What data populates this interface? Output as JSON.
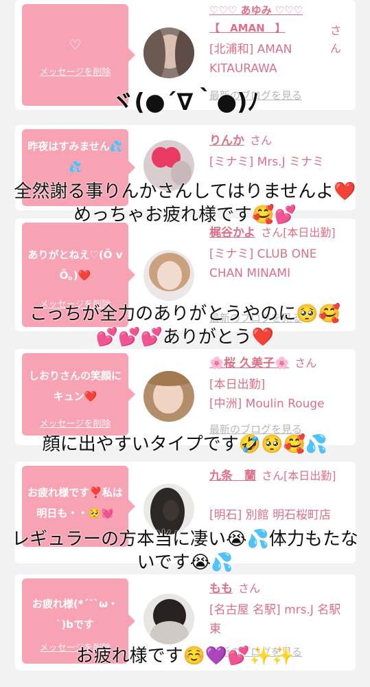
{
  "cards": [
    {
      "bubble_message": "♡",
      "delete_label": "メッセージを削除",
      "name": "♡♡♡ あゆみ ♡♡♡\n【　AMAN　】",
      "honorific": "さん",
      "shop": "[北浦和] AMAN KITAURAWA",
      "blog_label": "最新のブログを見る"
    },
    {
      "bubble_message": "昨夜はすみません💦💦",
      "delete_label": "",
      "name": "りんか",
      "honorific": "さん",
      "shop": "[ミナミ] Mrs.J ミナミ",
      "blog_label": ""
    },
    {
      "bubble_message": "ありがとねえ♡(Ö vÖ｡)❤️",
      "delete_label": "メッセージを削除",
      "name": "梶谷かよ",
      "honorific": "さん[本日出勤]",
      "shop": "[ミナミ] CLUB ONE CHAN MINAMI",
      "blog_label": "最新のブログを見る"
    },
    {
      "bubble_message": "しおりさんの笑顔にキュン❤️",
      "delete_label": "メッセージを削除",
      "name": "🌸桜 久美子🌸",
      "honorific": "さん",
      "shop": "[本日出勤]\n[中洲] Moulin Rouge",
      "blog_label": "最新のブログを見る"
    },
    {
      "bubble_message": "お疲れ様です❣️私は明日も・・🥺💓",
      "delete_label": "",
      "name": "九条　蘭",
      "honorific": "さん[本日出勤]",
      "shop": "[明石] 別館 明石桜町店",
      "blog_label": ""
    },
    {
      "bubble_message": "お疲れ様(*´˘`ω・`)bです",
      "delete_label": "メッセージを削除",
      "name": "もも",
      "honorific": "さん",
      "shop": "[名古屋 名駅] mrs.J 名駅東",
      "blog_label": "最新のブログを見る"
    }
  ],
  "captions": [
    "ヾ(●´∇｀●)ﾉ",
    "全然謝る事りんかさんしてはりませんよ❤️めっちゃお疲れ様です🥰💕",
    "こっちが全力のありがとうやのに🥺🥰\n💕💕💕ありがとう❤️",
    "顔に出やすいタイプです🤣🥺🥰💦",
    "レギュラーの方本当に凄い😭💦体力もたないです😭💦",
    "お疲れ様です☺️💜💕✨✨"
  ],
  "colors": {
    "bubble": "#f7a3b4",
    "accent_text": "#dd6f86",
    "blog_link": "#b7b7b7",
    "background": "#f2f2f2"
  }
}
